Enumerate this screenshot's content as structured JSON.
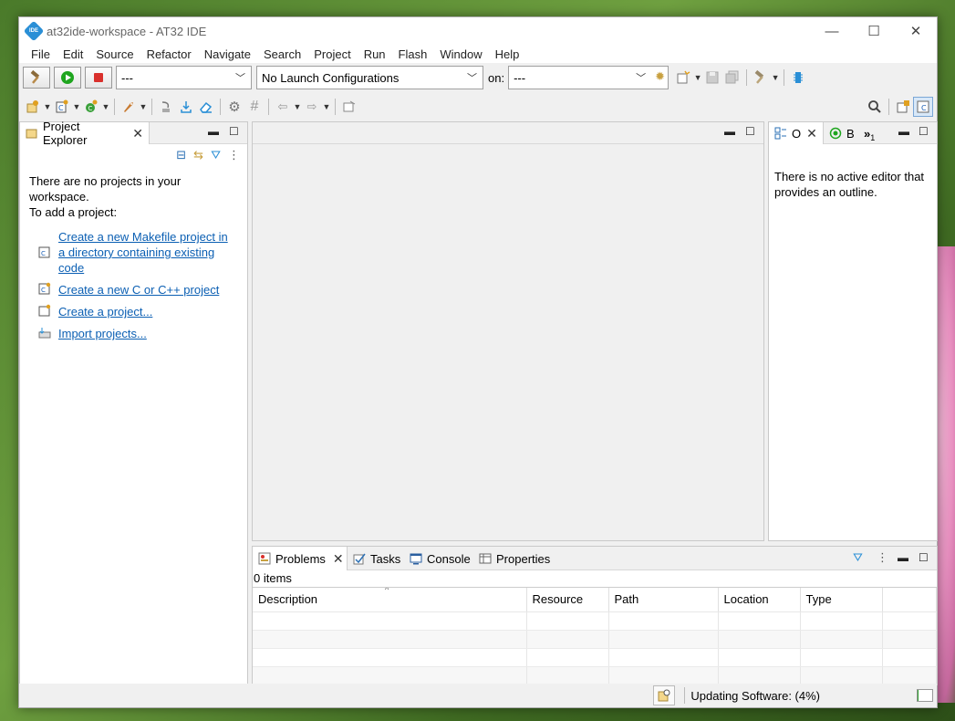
{
  "window": {
    "title": "at32ide-workspace - AT32 IDE",
    "app_icon_text": "IDE",
    "minimize": "—",
    "maximize": "☐",
    "close": "✕"
  },
  "menu": [
    "File",
    "Edit",
    "Source",
    "Refactor",
    "Navigate",
    "Search",
    "Project",
    "Run",
    "Flash",
    "Window",
    "Help"
  ],
  "toolbar": {
    "launch_mode": "---",
    "launch_config": "No Launch Configurations",
    "on_label": "on:",
    "launch_target": "---"
  },
  "project_explorer": {
    "tab_label": "Project Explorer",
    "empty_line1": "There are no projects in your",
    "empty_line2": "workspace.",
    "add_prompt": "To add a project:",
    "links": [
      "Create a new Makefile project in",
      "a directory containing existing",
      "code",
      "Create a new C or C++ project",
      "Create a project...",
      "Import projects..."
    ]
  },
  "outline": {
    "tab_o": "O",
    "tab_b": "B",
    "overflow": "»",
    "overflow_count": "1",
    "message_line1": "There is no active editor that",
    "message_line2": "provides an outline."
  },
  "problems": {
    "tabs": [
      "Problems",
      "Tasks",
      "Console",
      "Properties"
    ],
    "count": "0 items",
    "columns": [
      "Description",
      "Resource",
      "Path",
      "Location",
      "Type"
    ]
  },
  "status": {
    "text": "Updating Software: (4%)",
    "progress": 0.04
  },
  "colors": {
    "link": "#0b5fb3",
    "run_green": "#1ea51e",
    "stop_red": "#d9302c",
    "accent_blue": "#2a8fd6"
  }
}
